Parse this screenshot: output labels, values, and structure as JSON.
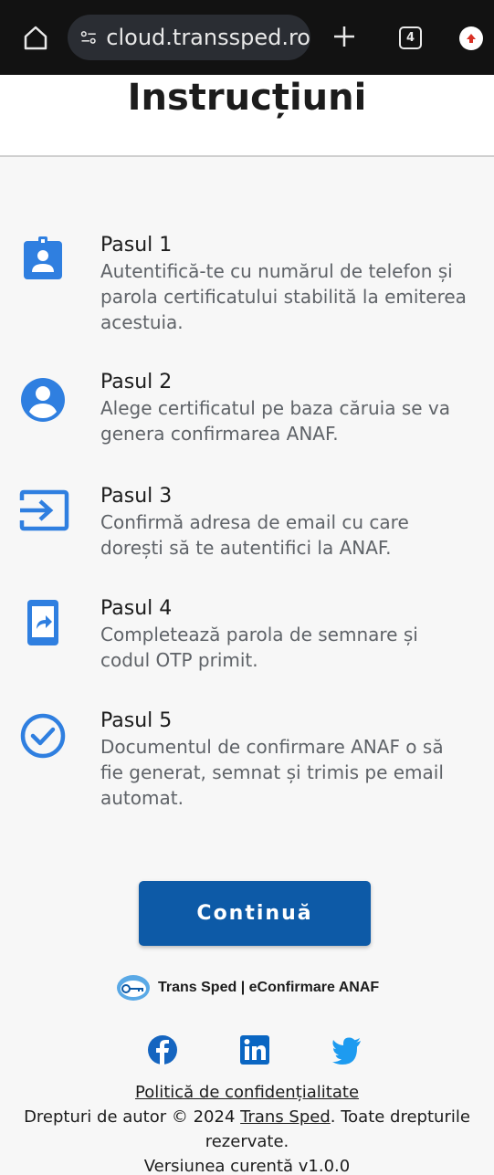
{
  "browser": {
    "url": "cloud.transsped.ro",
    "tab_count": "4"
  },
  "header": {
    "title": "Instrucțiuni"
  },
  "steps": [
    {
      "title": "Pasul 1",
      "desc_lines": [
        "Autentifică-te cu numărul de telefon și",
        "parola certificatului stabilită la emiterea",
        "acestuia."
      ],
      "icon": "badge-icon"
    },
    {
      "title": "Pasul 2",
      "desc_lines": [
        "Alege certificatul pe baza căruia se va",
        "genera confirmarea ANAF."
      ],
      "icon": "account-circle-icon"
    },
    {
      "title": "Pasul 3",
      "desc_lines": [
        "Confirmă adresa de email cu care",
        "dorești să te autentifici la ANAF."
      ],
      "icon": "login-arrow-icon"
    },
    {
      "title": "Pasul 4",
      "desc_lines": [
        "Completează parola de semnare și",
        "codul OTP primit."
      ],
      "icon": "phone-forward-icon"
    },
    {
      "title": "Pasul 5",
      "desc_lines": [
        "Documentul de confirmare ANAF o să",
        "fie generat, semnat și trimis pe email",
        "automat."
      ],
      "icon": "check-circle-icon"
    }
  ],
  "continue_label": "Continuă",
  "brand_text": "Trans Sped | eConfirmare ANAF",
  "footer": {
    "privacy": "Politică de confidențialitate",
    "copyright_prefix": "Drepturi de autor © 2024 ",
    "company_link": "Trans Sped",
    "copyright_suffix": ". Toate drepturile",
    "line3": "rezervate.",
    "version": "Versiunea curentă v1.0.0"
  },
  "colors": {
    "accent": "#0d5aa7",
    "icon_blue": "#2f7fe0",
    "facebook": "#1565c0",
    "linkedin": "#0a66c2",
    "twitter": "#1d9bf0"
  }
}
